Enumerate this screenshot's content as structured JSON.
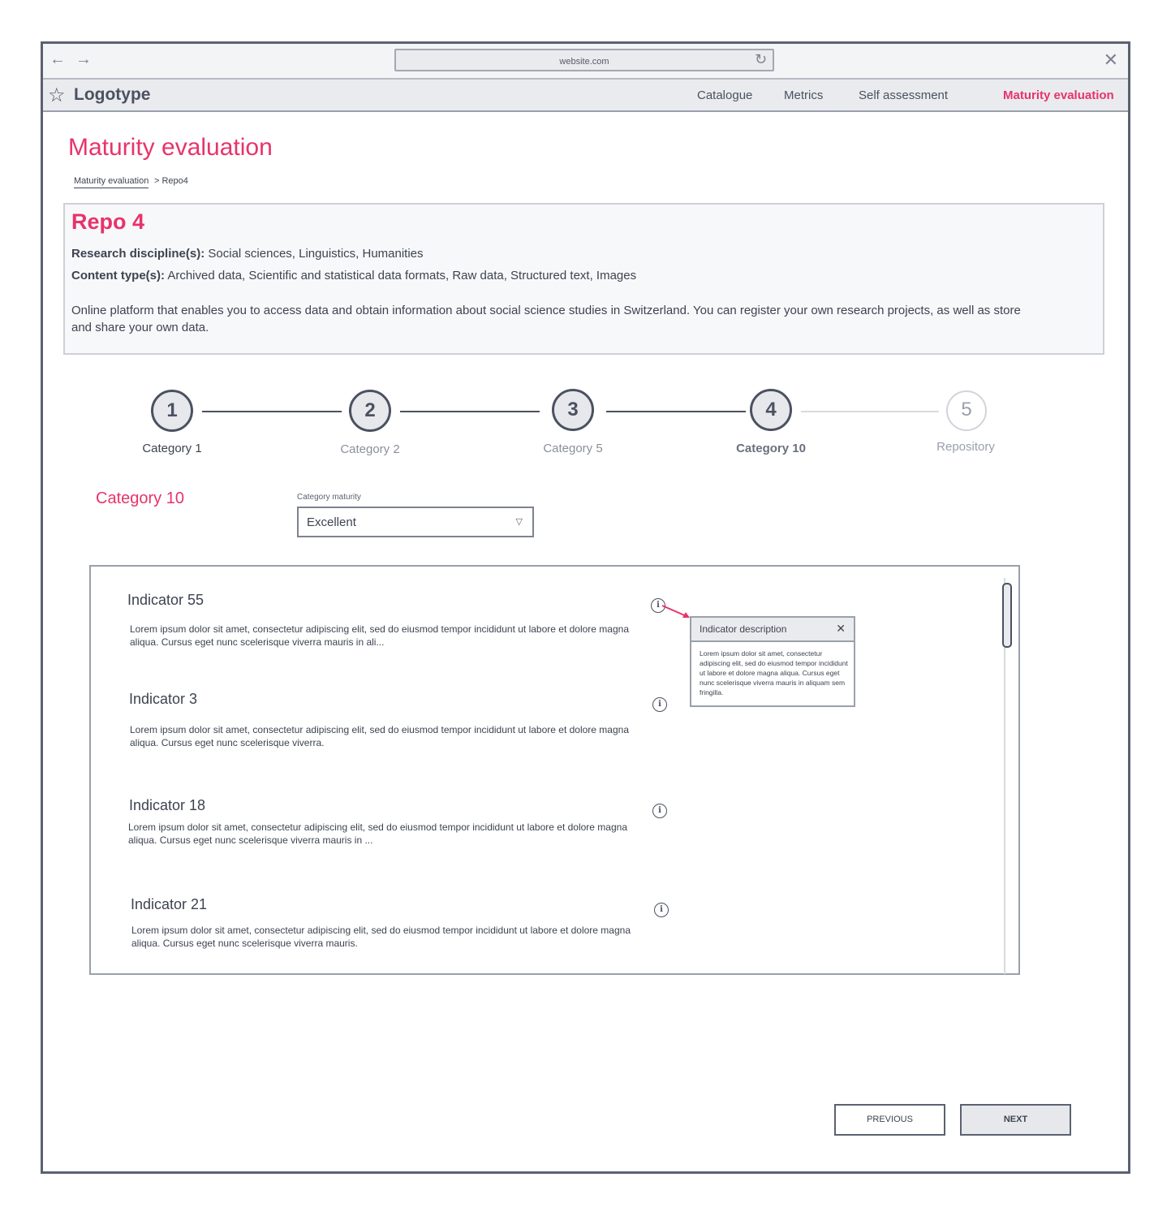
{
  "browser": {
    "back_icon": "←",
    "forward_icon": "→",
    "url": "website.com",
    "reload_icon": "↻",
    "close_icon": "✕"
  },
  "nav": {
    "logo_icon": "☆",
    "logo_text": "Logotype",
    "items": [
      {
        "label": "Catalogue"
      },
      {
        "label": "Metrics"
      },
      {
        "label": "Self assessment"
      },
      {
        "label": "Maturity evaluation"
      }
    ],
    "active_color": "#e8336a"
  },
  "page": {
    "title": "Maturity evaluation",
    "breadcrumb": {
      "root": "Maturity evaluation",
      "current": "> Repo4"
    }
  },
  "repo": {
    "title": "Repo 4",
    "discipline_label": "Research discipline(s):",
    "discipline_value": " Social sciences, Linguistics, Humanities",
    "content_label": "Content type(s):",
    "content_value": " Archived data, Scientific and statistical data formats, Raw data, Structured text, Images",
    "description": "Online platform that enables you to access data and obtain information about social science studies in Switzerland. You can register your own research projects, as well as store and share your own data."
  },
  "stepper": {
    "steps": [
      {
        "number": "1",
        "label": "Category 1",
        "state": "done"
      },
      {
        "number": "2",
        "label": "Category 2",
        "state": "done"
      },
      {
        "number": "3",
        "label": "Category 5",
        "state": "done"
      },
      {
        "number": "4",
        "label": "Category 10",
        "state": "current"
      },
      {
        "number": "5",
        "label": "Repository",
        "state": "todo"
      }
    ]
  },
  "category": {
    "title": "Category 10",
    "maturity_label": "Category maturity",
    "maturity_value": "Excellent",
    "caret_icon": "▽"
  },
  "indicators": [
    {
      "title": "Indicator 55",
      "text": "Lorem ipsum dolor sit amet, consectetur adipiscing elit, sed do eiusmod tempor incididunt ut labore et dolore magna aliqua. Cursus eget nunc scelerisque viverra mauris in ali..."
    },
    {
      "title": "Indicator 3",
      "text": "Lorem ipsum dolor sit amet, consectetur adipiscing elit, sed do eiusmod tempor incididunt ut labore et dolore magna aliqua. Cursus eget nunc scelerisque viverra."
    },
    {
      "title": "Indicator 18",
      "text": "Lorem ipsum dolor sit amet, consectetur adipiscing elit, sed do eiusmod tempor incididunt ut labore et dolore magna aliqua. Cursus eget nunc scelerisque viverra mauris in  ..."
    },
    {
      "title": "Indicator 21",
      "text": "Lorem ipsum dolor sit amet, consectetur adipiscing elit, sed do eiusmod tempor incididunt ut labore et dolore magna aliqua. Cursus eget nunc scelerisque viverra mauris."
    }
  ],
  "info_icon": "i",
  "popover": {
    "title": "Indicator description",
    "close_icon": "✕",
    "text": "Lorem ipsum dolor sit amet, consectetur adipiscing elit, sed do eiusmod tempor incididunt ut labore et dolore magna aliqua. Cursus eget nunc scelerisque viverra mauris in aliquam sem fringilla."
  },
  "buttons": {
    "previous": "PREVIOUS",
    "next": "NEXT"
  }
}
